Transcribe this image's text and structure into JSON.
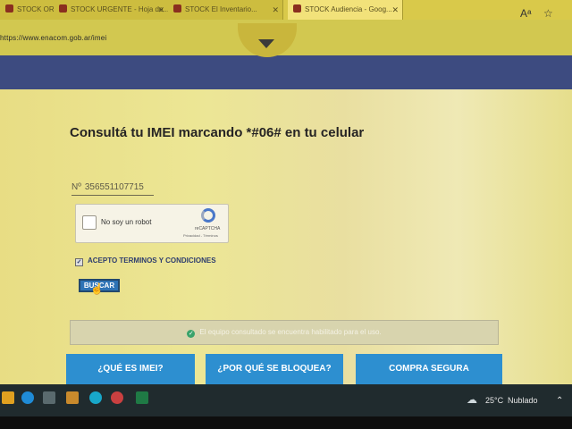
{
  "browser": {
    "tabs": [
      {
        "label": "STOCK ORIGINAL - Hoja de..."
      },
      {
        "label": "STOCK URGENTE - Hoja de..."
      },
      {
        "label": "STOCK El Inventario..."
      },
      {
        "label": "STOCK Audiencia - Goog..."
      }
    ],
    "url": "https://www.enacom.gob.ar/imei"
  },
  "page": {
    "title": "Consultá tu IMEI marcando *#06# en tu celular",
    "imei_label": "Nº",
    "imei_value": "356551107715",
    "recaptcha": {
      "label": "No soy un robot",
      "brand": "reCAPTCHA",
      "links": "Privacidad - Términos"
    },
    "terms_label": "ACEPTO TERMINOS Y CONDICIONES",
    "search_button": "BUSCAR",
    "result_message": "El equipo consultado se encuentra habilitado para el uso.",
    "nav_buttons": [
      {
        "label": "¿QUÉ ES IMEI?"
      },
      {
        "label": "¿POR QUÉ SE BLOQUEA?"
      },
      {
        "label": "COMPRA SEGURA"
      }
    ]
  },
  "taskbar": {
    "weather_temp": "25°C",
    "weather_text": "Nublado"
  },
  "colors": {
    "accent_blue": "#2d8fd0",
    "navy": "#3d4b80",
    "success_green": "#3aa36b"
  }
}
